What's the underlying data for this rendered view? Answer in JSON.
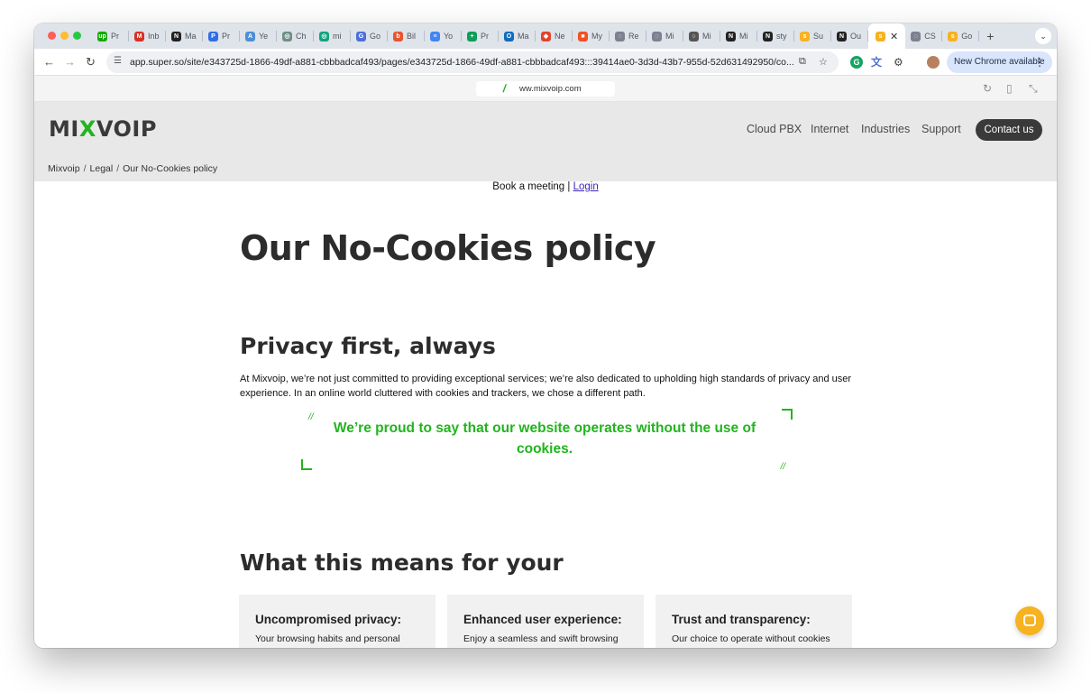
{
  "browser": {
    "tabs": [
      {
        "label": "Pr",
        "icon": "upwork-icon",
        "color": "#14a800",
        "glyph": "up"
      },
      {
        "label": "Inb",
        "icon": "gmail-icon",
        "color": "#d93025",
        "glyph": "M"
      },
      {
        "label": "Ma",
        "icon": "notion-icon",
        "color": "#222222",
        "glyph": "N"
      },
      {
        "label": "Pr",
        "icon": "docs-icon",
        "color": "#2f6ee6",
        "glyph": "P"
      },
      {
        "label": "Ye",
        "icon": "app-icon",
        "color": "#4c8fd6",
        "glyph": "A"
      },
      {
        "label": "Ch",
        "icon": "chatgpt-icon",
        "color": "#6f8f86",
        "glyph": "◎"
      },
      {
        "label": "mi",
        "icon": "chatgpt-icon",
        "color": "#10a37f",
        "glyph": "◎"
      },
      {
        "label": "Go",
        "icon": "translate-icon",
        "color": "#4f6fd8",
        "glyph": "G"
      },
      {
        "label": "Bil",
        "icon": "billing-icon",
        "color": "#e8542f",
        "glyph": "b"
      },
      {
        "label": "Yo",
        "icon": "docs-icon",
        "color": "#4285f4",
        "glyph": "≡"
      },
      {
        "label": "Pr",
        "icon": "sheets-icon",
        "color": "#0f9d58",
        "glyph": "+"
      },
      {
        "label": "Ma",
        "icon": "outlook-icon",
        "color": "#0f6cbd",
        "glyph": "O"
      },
      {
        "label": "Ne",
        "icon": "gitlab-icon",
        "color": "#e24329",
        "glyph": "◆"
      },
      {
        "label": "My",
        "icon": "microsoft-icon",
        "color": "#f25022",
        "glyph": "■"
      },
      {
        "label": "Re",
        "icon": "app-icon",
        "color": "#7b8190",
        "glyph": "◌"
      },
      {
        "label": "Mi",
        "icon": "app-icon",
        "color": "#7b8190",
        "glyph": "◌"
      },
      {
        "label": "Mi",
        "icon": "app-icon",
        "color": "#555555",
        "glyph": "○"
      },
      {
        "label": "Mi",
        "icon": "notion-icon",
        "color": "#222222",
        "glyph": "N"
      },
      {
        "label": "sty",
        "icon": "notion-icon",
        "color": "#222222",
        "glyph": "N"
      },
      {
        "label": "Su",
        "icon": "super-icon",
        "color": "#f7b21f",
        "glyph": "s"
      },
      {
        "label": "Ou",
        "icon": "notion-icon",
        "color": "#222222",
        "glyph": "N"
      },
      {
        "label": "",
        "icon": "super-icon",
        "color": "#f7b21f",
        "glyph": "s",
        "active": true
      },
      {
        "label": "CS",
        "icon": "app-icon",
        "color": "#7b8190",
        "glyph": "◌"
      },
      {
        "label": "Go",
        "icon": "super-icon",
        "color": "#f7b21f",
        "glyph": "s"
      }
    ],
    "url": "app.super.so/site/e343725d-1866-49df-a881-cbbbadcaf493/pages/e343725d-1866-49df-a881-cbbbadcaf493:::39414ae0-3d3d-43b7-955d-52d631492950/co...",
    "update_button": "New Chrome available"
  },
  "preview": {
    "domain": "ww.mixvoip.com"
  },
  "site": {
    "logo": {
      "part1": "MI",
      "x": "X",
      "part2": "VOIP"
    },
    "nav": [
      "Cloud PBX",
      "Internet",
      "Industries",
      "Support"
    ],
    "contact": "Contact us",
    "breadcrumb": [
      "Mixvoip",
      "Legal",
      "Our No-Cookies policy"
    ]
  },
  "content": {
    "book_text": "Book a meeting | ",
    "login_text": "Login",
    "title": "Our No-Cookies policy",
    "section1_title": "Privacy first, always",
    "section1_body": "At Mixvoip, we’re not just committed to providing exceptional services; we’re also dedicated to upholding high standards of privacy and user experience. In an online world cluttered with cookies and trackers, we chose a different path.",
    "quote": "We’re proud to say that our website operates without the use of cookies.",
    "section2_title": "What this means for your",
    "cards": [
      {
        "title": "Uncompromised privacy:",
        "body": "Your browsing habits and personal information remain your own. Without cookies, our website does not track"
      },
      {
        "title": "Enhanced user experience:",
        "body": "Enjoy a seamless and swift browsing experience without the interruptions of cookie consent pop-ups. We"
      },
      {
        "title": "Trust and transparency:",
        "body": "Our choice to operate without cookies reflects our commitment to transparency and building trust with"
      }
    ]
  },
  "colors": {
    "brand_green": "#22b41e",
    "header_bg": "#e8e8e8",
    "dark": "#3a3a3a"
  }
}
